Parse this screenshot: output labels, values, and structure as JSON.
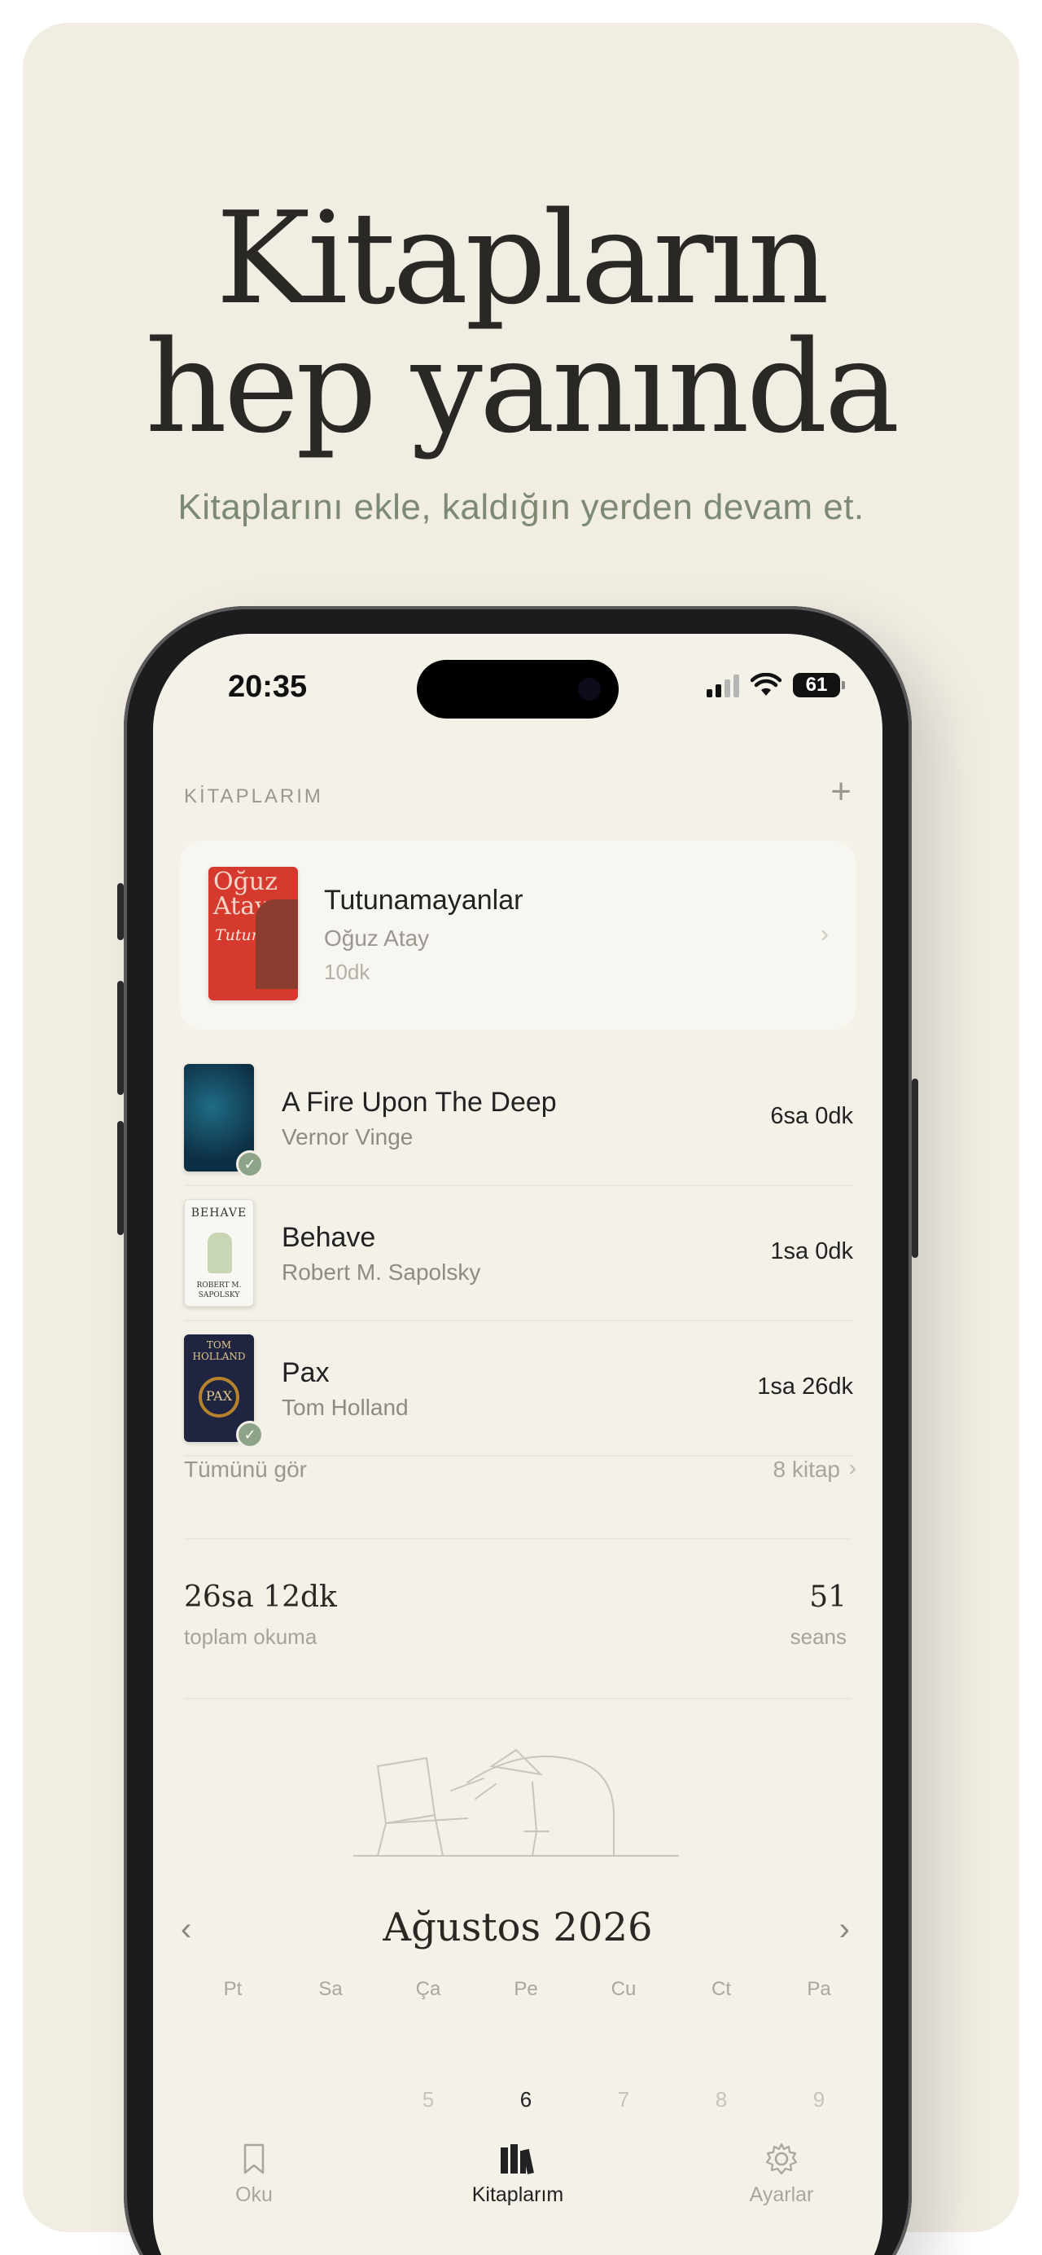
{
  "hero": {
    "title_line1": "Kitapların",
    "title_line2": "hep yanında",
    "subtitle": "Kitaplarını ekle, kaldığın yerden devam et."
  },
  "status_bar": {
    "time": "20:35",
    "battery": "61"
  },
  "library": {
    "section_label": "KİTAPLARIM",
    "add_icon": "+",
    "current": {
      "title": "Tutunamayanlar",
      "author": "Oğuz Atay",
      "time": "10dk",
      "cover_text_top": "Oğuz Atay",
      "cover_text_bottom": "Tutunamayanlar"
    },
    "books": [
      {
        "title": "A Fire Upon The Deep",
        "author": "Vernor Vinge",
        "time": "6sa 0dk",
        "finished": true
      },
      {
        "title": "Behave",
        "author": "Robert M. Sapolsky",
        "time": "1sa 0dk",
        "finished": false
      },
      {
        "title": "Pax",
        "author": "Tom Holland",
        "time": "1sa 26dk",
        "finished": true
      }
    ],
    "see_all": "Tümünü gör",
    "count": "8 kitap"
  },
  "stats": {
    "total_value": "26sa 12dk",
    "total_label": "toplam okuma",
    "sessions_value": "51",
    "sessions_label": "seans"
  },
  "calendar": {
    "month": "Ağustos 2026",
    "weekdays": [
      "Pt",
      "Sa",
      "Ça",
      "Pe",
      "Cu",
      "Ct",
      "Pa"
    ],
    "visible_days": [
      "",
      "",
      "5",
      "6",
      "7",
      "8",
      "9"
    ],
    "today": "6"
  },
  "tabs": [
    {
      "label": "Oku",
      "icon": "bookmark-icon",
      "active": false
    },
    {
      "label": "Kitaplarım",
      "icon": "books-icon",
      "active": true
    },
    {
      "label": "Ayarlar",
      "icon": "gear-icon",
      "active": false
    }
  ],
  "colors": {
    "panel_bg": "#f1ede3",
    "screen_bg": "#f4f1e8",
    "subtitle_green": "#7d8a73",
    "check_green": "#8ea488"
  }
}
